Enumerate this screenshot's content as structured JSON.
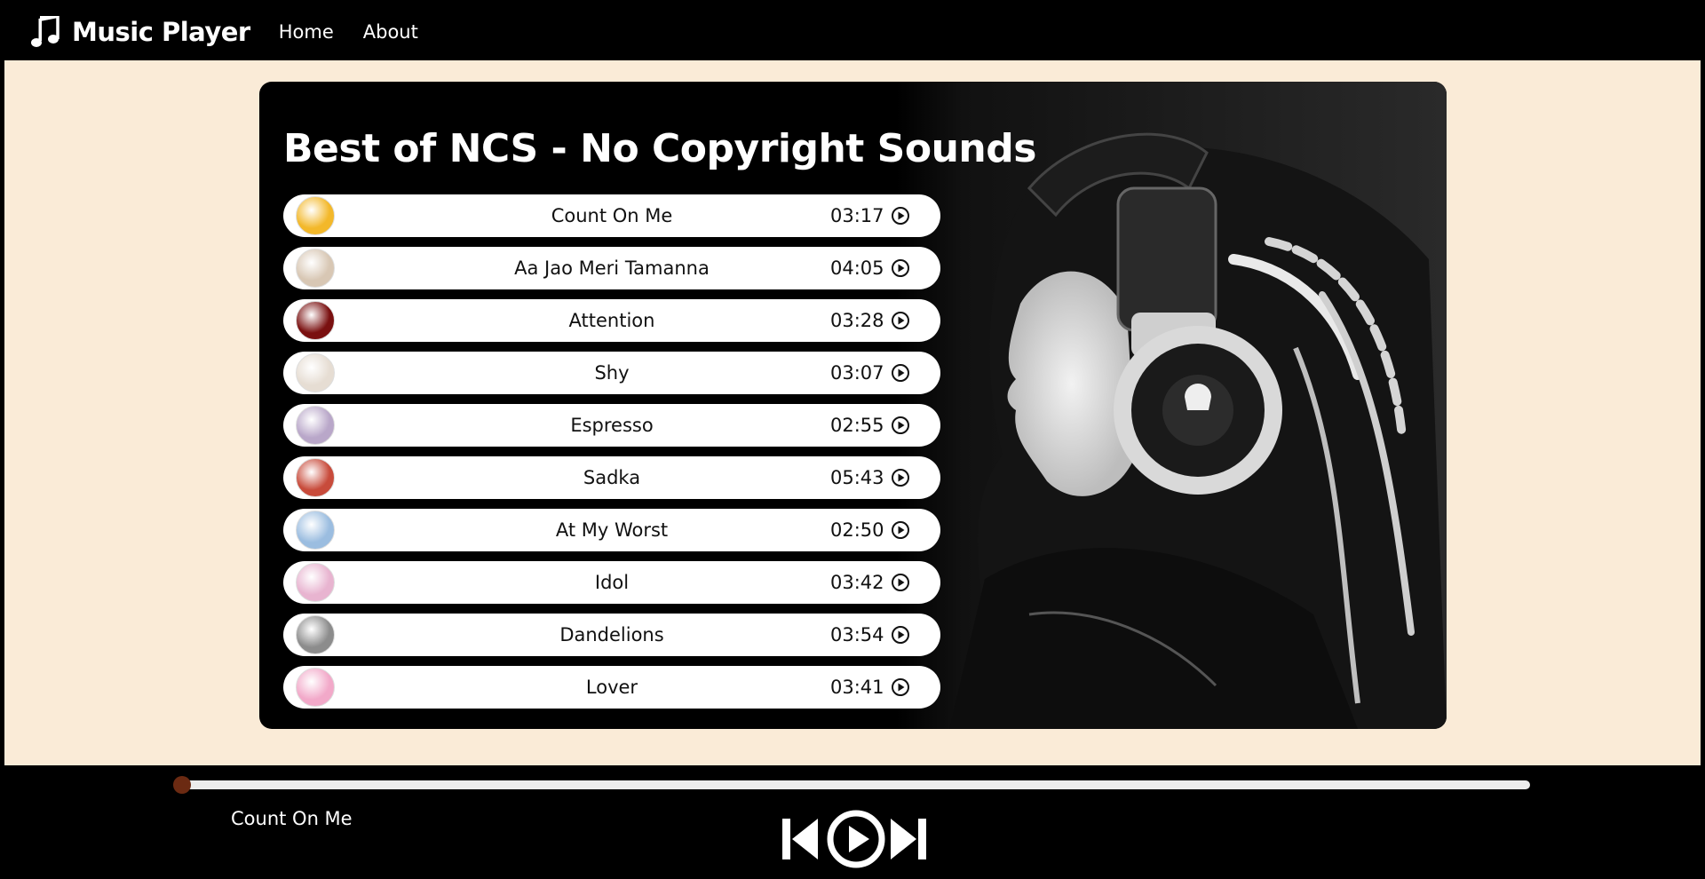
{
  "navbar": {
    "brand": "Music Player",
    "links": [
      "Home",
      "About"
    ]
  },
  "playlist": {
    "title": "Best of NCS - No Copyright Sounds",
    "songs": [
      {
        "name": "Count On Me",
        "duration": "03:17",
        "thumb_color": "#f3b82a"
      },
      {
        "name": "Aa Jao Meri Tamanna",
        "duration": "04:05",
        "thumb_color": "#d8c7b4"
      },
      {
        "name": "Attention",
        "duration": "03:28",
        "thumb_color": "#7a1010"
      },
      {
        "name": "Shy",
        "duration": "03:07",
        "thumb_color": "#e6ddd3"
      },
      {
        "name": "Espresso",
        "duration": "02:55",
        "thumb_color": "#b9a7c9"
      },
      {
        "name": "Sadka",
        "duration": "05:43",
        "thumb_color": "#c84b3b"
      },
      {
        "name": "At My Worst",
        "duration": "02:50",
        "thumb_color": "#9bbde0"
      },
      {
        "name": "Idol",
        "duration": "03:42",
        "thumb_color": "#e8b4d0"
      },
      {
        "name": "Dandelions",
        "duration": "03:54",
        "thumb_color": "#8c8c8c"
      },
      {
        "name": "Lover",
        "duration": "03:41",
        "thumb_color": "#f2a9c9"
      }
    ]
  },
  "player": {
    "now_playing": "Count On Me",
    "progress": 0
  },
  "colors": {
    "page_background": "#faebd7",
    "bar_background": "#000000",
    "progress_thumb": "#6b2a12"
  },
  "icons": {
    "brand": "music-note-icon",
    "song_play": "play-circle-icon",
    "prev": "skip-back-icon",
    "play": "play-circle-icon",
    "next": "skip-forward-icon"
  }
}
